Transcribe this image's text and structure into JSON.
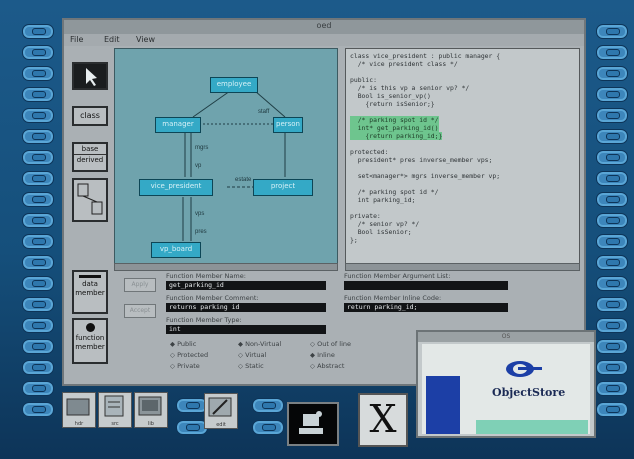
{
  "window": {
    "title": "oed"
  },
  "menu": {
    "file": "File",
    "edit": "Edit",
    "view": "View"
  },
  "tools": {
    "class": "class",
    "base_derived_1": "base",
    "base_derived_2": "derived",
    "data_member_1": "data",
    "data_member_2": "member",
    "function_member_1": "function",
    "function_member_2": "member"
  },
  "diagram": {
    "nodes": {
      "employee": "employee",
      "manager": "manager",
      "vice_president": "vice_president",
      "vp_board": "vp_board",
      "person": "person",
      "project": "project"
    },
    "edges": {
      "staff": "staff",
      "mgrs": "mgrs",
      "vp": "vp",
      "vps": "vps",
      "pres": "pres",
      "estate": "estate"
    }
  },
  "code_lines": [
    "class vice_president : public manager {",
    "  /* vice president class */",
    "",
    "public:",
    "  /* is this vp a senior vp? */",
    "  Bool is_senior_vp()",
    "    {return isSenior;}",
    "",
    "  /* parking spot id */",
    "  int* get_parking_id()",
    "    {return parking_id;}",
    "",
    "protected:",
    "  president* pres inverse_member vps;",
    "",
    "  set<manager*> mgrs inverse_member vp;",
    "",
    "  /* parking spot id */",
    "  int parking_id;",
    "",
    "private:",
    "  /* senior vp? */",
    "  Bool isSenior;",
    "};"
  ],
  "form": {
    "name_label": "Function Member Name:",
    "name_value": "get_parking_id",
    "arglist_label": "Function Member Argument List:",
    "arglist_value": "",
    "comment_label": "Function Member Comment:",
    "comment_value": "returns parking id",
    "inline_label": "Function Member Inline Code:",
    "inline_value": "return parking_id;",
    "type_label": "Function Member Type:",
    "type_value": "int",
    "btn_apply": "Apply",
    "btn_accept": "Accept",
    "radios": [
      "Public",
      "Protected",
      "Private",
      "Non-Virtual",
      "Virtual",
      "Static",
      "Out of line",
      "Inline",
      "Abstract"
    ]
  },
  "dock": {
    "icons": [
      "folder-icon",
      "document-icon",
      "terminal-icon",
      "editor-icon"
    ],
    "labels": [
      "hdr",
      "src",
      "lib",
      "edit"
    ]
  },
  "objectstore": {
    "title": "OS",
    "brand": "ObjectStore"
  }
}
